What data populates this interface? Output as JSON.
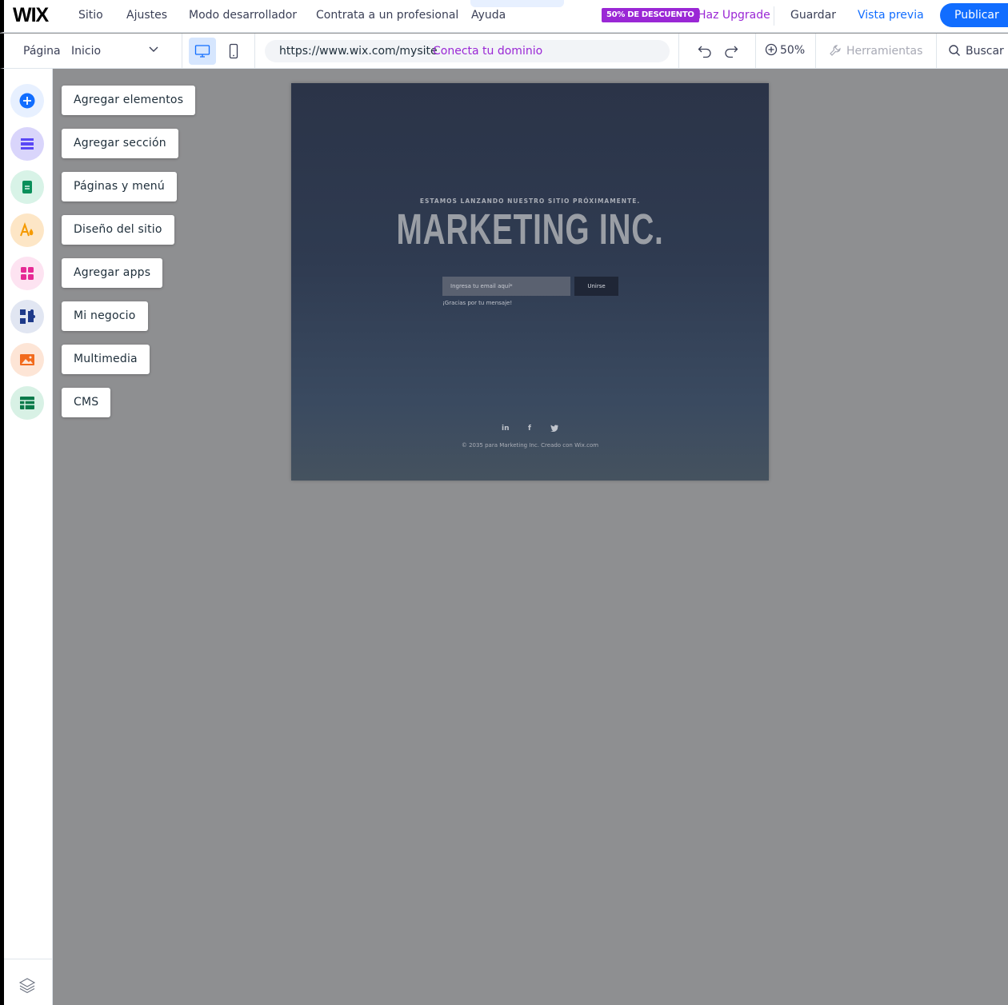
{
  "topbar": {
    "logo": "WIX",
    "menu": [
      "Sitio",
      "Ajustes",
      "Modo desarrollador",
      "Contrata a un profesional",
      "Ayuda"
    ],
    "collapse_glyph": "ˆ",
    "discount_badge": "50% DE DESCUENTO",
    "upgrade_label": "Haz Upgrade",
    "save_label": "Guardar",
    "preview_label": "Vista previa",
    "publish_label": "Publicar"
  },
  "secbar": {
    "page_label": "Página",
    "page_value": "Inicio",
    "url": "https://www.wix.com/mysite",
    "connect_domain": "Conecta tu dominio",
    "zoom": "50%",
    "tools_label": "Herramientas",
    "search_label": "Buscar"
  },
  "leftrail": {
    "items": [
      {
        "label": "Agregar elementos",
        "icon": "plus-circle-icon",
        "color": "#116dff"
      },
      {
        "label": "Agregar sección",
        "icon": "section-icon",
        "color": "#5a48f5"
      },
      {
        "label": "Páginas y menú",
        "icon": "page-icon",
        "color": "#0a8f5a"
      },
      {
        "label": "Diseño del sitio",
        "icon": "design-icon",
        "color": "#f59a00"
      },
      {
        "label": "Agregar apps",
        "icon": "apps-grid-icon",
        "color": "#e62a95"
      },
      {
        "label": "Mi negocio",
        "icon": "business-icon",
        "color": "#1e3a8a"
      },
      {
        "label": "Multimedia",
        "icon": "image-icon",
        "color": "#f26b1d"
      },
      {
        "label": "CMS",
        "icon": "cms-table-icon",
        "color": "#0a7a4a"
      }
    ]
  },
  "site": {
    "coming_soon": "ESTAMOS LANZANDO NUESTRO SITIO PRÓXIMAMENTE.",
    "brand": "MARKETING INC.",
    "email_placeholder": "Ingresa tu email aquí*",
    "join_label": "Unirse",
    "thanks": "¡Gracias por tu mensaje!",
    "social": [
      "in",
      "f"
    ],
    "copyright": "© 2035 para Marketing Inc. Creado con Wix.com"
  }
}
